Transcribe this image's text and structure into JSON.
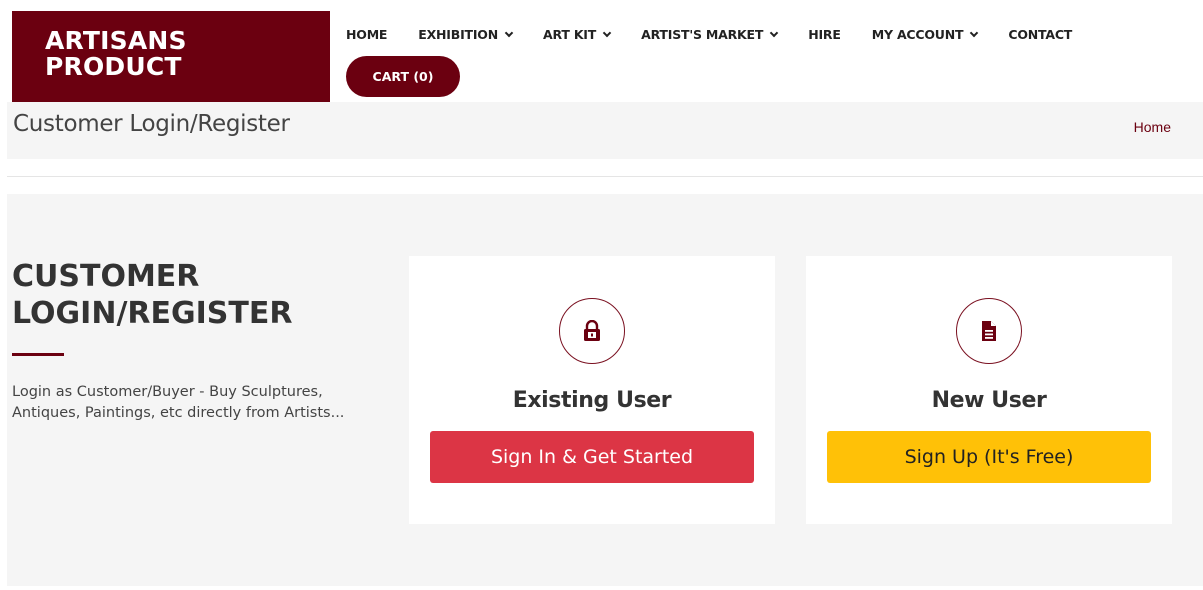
{
  "brand": {
    "line1": "ARTISANS",
    "line2": "PRODUCT",
    "color": "#6b0010"
  },
  "nav": {
    "items": [
      {
        "label": "HOME",
        "dropdown": false
      },
      {
        "label": "EXHIBITION",
        "dropdown": true
      },
      {
        "label": "ART KIT",
        "dropdown": true
      },
      {
        "label": "ARTIST'S MARKET",
        "dropdown": true
      },
      {
        "label": "HIRE",
        "dropdown": false
      },
      {
        "label": "MY ACCOUNT",
        "dropdown": true
      },
      {
        "label": "CONTACT",
        "dropdown": false
      }
    ],
    "cart_label": "CART (0)"
  },
  "title_bar": {
    "title": "Customer Login/Register",
    "breadcrumb": "Home"
  },
  "intro": {
    "heading_line1": "CUSTOMER",
    "heading_line2": "LOGIN/REGISTER",
    "description": "Login as Customer/Buyer - Buy Sculptures, Antiques, Paintings, etc directly from Artists..."
  },
  "cards": {
    "existing": {
      "icon": "lock-icon",
      "title": "Existing User",
      "button": "Sign In & Get Started",
      "button_color": "#dc3545"
    },
    "new": {
      "icon": "document-icon",
      "title": "New User",
      "button": "Sign Up (It's Free)",
      "button_color": "#ffc107"
    }
  }
}
